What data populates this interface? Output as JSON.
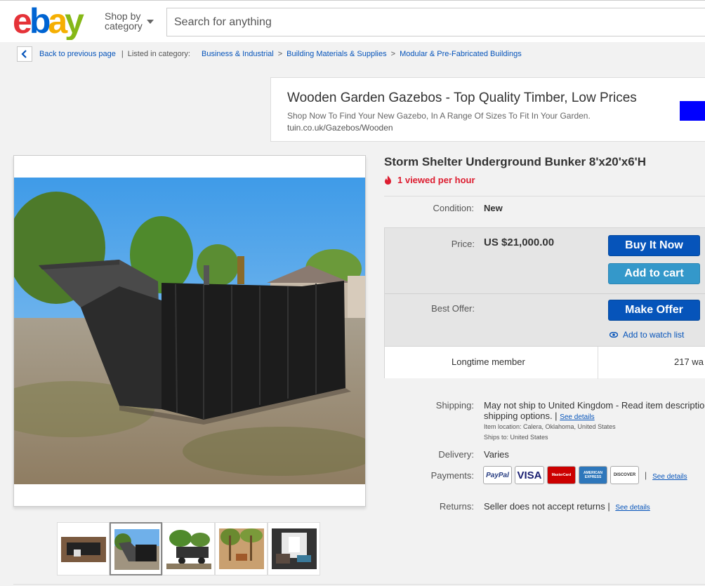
{
  "header": {
    "logo_text": "ebay",
    "shop_by_line1": "Shop by",
    "shop_by_line2": "category",
    "search_placeholder": "Search for anything",
    "colors": {
      "e": "#e53238",
      "b": "#0064d2",
      "a": "#f5af02",
      "y": "#86b817"
    }
  },
  "breadcrumb": {
    "back_label": "Back to previous page",
    "listed_label": "Listed in category:",
    "items": [
      "Business & Industrial",
      "Building Materials & Supplies",
      "Modular & Pre-Fabricated Buildings"
    ]
  },
  "ad": {
    "title": "Wooden Garden Gazebos - Top Quality Timber, Low Prices",
    "description": "Shop Now To Find Your New Gazebo, In A Range Of Sizes To Fit In Your Garden.",
    "url": "tuin.co.uk/Gazebos/Wooden"
  },
  "listing": {
    "title": "Storm Shelter Underground Bunker 8'x20'x6'H",
    "viewed": "1 viewed per hour",
    "condition_label": "Condition:",
    "condition_value": "New",
    "price_label": "Price:",
    "price_value": "US $21,000.00",
    "buy_it_now": "Buy It Now",
    "add_to_cart": "Add to cart",
    "best_offer_label": "Best Offer:",
    "make_offer": "Make Offer",
    "watch_list": "Add to watch list",
    "member_text": "Longtime member",
    "watchers_text": "217 wa"
  },
  "details": {
    "shipping_label": "Shipping:",
    "shipping_line1": "May not ship to United Kingdom - Read item description",
    "shipping_line2": "shipping options. |",
    "see_details": "See details",
    "item_location": "Item location:  Calera, Oklahoma, United States",
    "ships_to": "Ships to:  United States",
    "delivery_label": "Delivery:",
    "delivery_value": "Varies",
    "payments_label": "Payments:",
    "payment_methods": [
      "PayPal",
      "VISA",
      "MasterCard",
      "AMERICAN EXPRESS",
      "DISCOVER"
    ],
    "returns_label": "Returns:",
    "returns_value": "Seller does not accept returns |"
  },
  "thumbnails": [
    "thumb-1",
    "thumb-2",
    "thumb-3",
    "thumb-4",
    "thumb-5"
  ]
}
